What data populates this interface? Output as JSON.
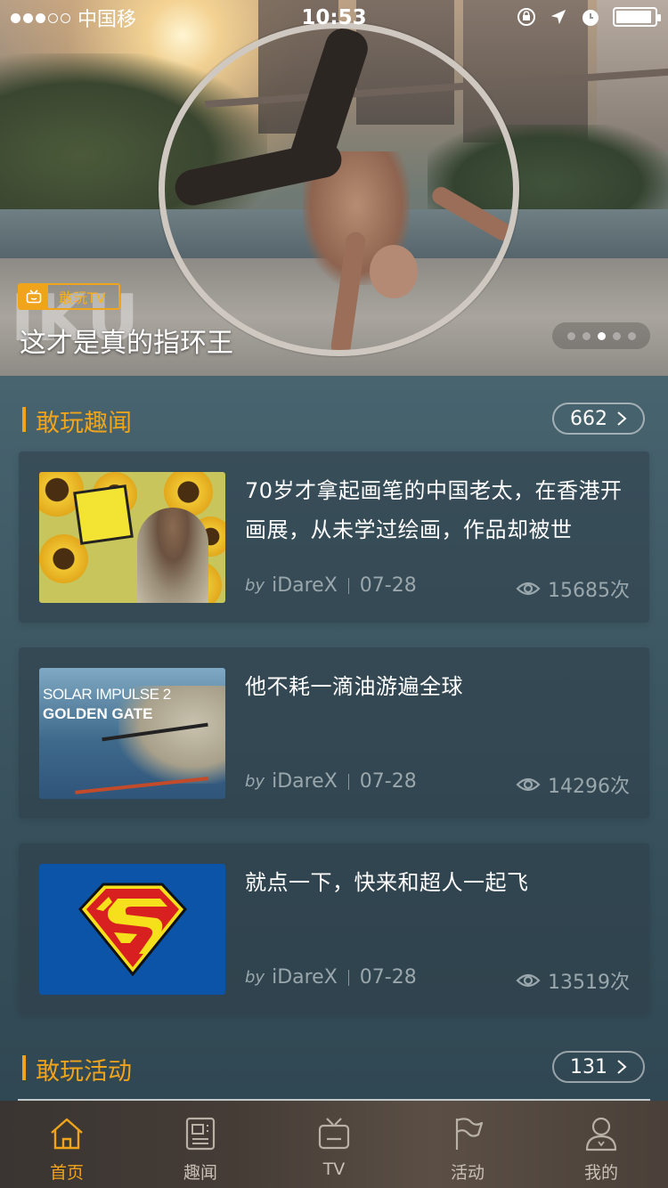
{
  "status_bar": {
    "carrier": "中国移",
    "time": "10:53",
    "battery_level": 0.92
  },
  "banner": {
    "tag_label": "敢玩TV",
    "watermark": "IKU",
    "title": "这才是真的指环王",
    "dots_total": 5,
    "dot_active_index": 2
  },
  "sections": {
    "news": {
      "title": "敢玩趣闻",
      "count": "662"
    },
    "activities": {
      "title": "敢玩活动",
      "count": "131"
    }
  },
  "articles": [
    {
      "title": "70岁才拿起画笔的中国老太，在香港开画展，从未学过绘画，作品却被世",
      "by": "by",
      "author": "iDareX",
      "date": "07-28",
      "views": "15685次",
      "thumb_icon": "sunflower-painting-image"
    },
    {
      "title": "他不耗一滴油游遍全球",
      "by": "by",
      "author": "iDareX",
      "date": "07-28",
      "views": "14296次",
      "thumb_icon": "solar-plane-image",
      "thumb_text1": "SOLAR IMPULSE 2",
      "thumb_text2": "GOLDEN GATE"
    },
    {
      "title": "就点一下，快来和超人一起飞",
      "by": "by",
      "author": "iDareX",
      "date": "07-28",
      "views": "13519次",
      "thumb_icon": "superman-logo-image"
    }
  ],
  "tabbar": [
    {
      "label": "首页",
      "icon": "home-icon",
      "active": true
    },
    {
      "label": "趣闻",
      "icon": "news-icon",
      "active": false
    },
    {
      "label": "TV",
      "icon": "tv-icon",
      "active": false
    },
    {
      "label": "活动",
      "icon": "flag-icon",
      "active": false
    },
    {
      "label": "我的",
      "icon": "user-icon",
      "active": false
    }
  ],
  "colors": {
    "accent": "#f0a41b",
    "muted_text": "#9aa7ac"
  }
}
